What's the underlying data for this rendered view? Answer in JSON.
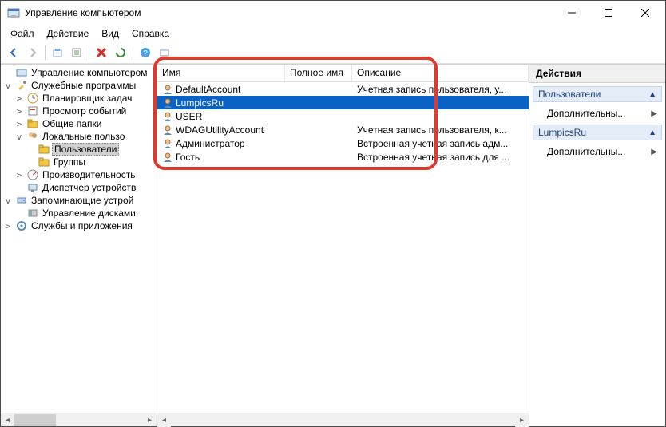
{
  "window": {
    "title": "Управление компьютером"
  },
  "menu": {
    "file": "Файл",
    "action": "Действие",
    "view": "Вид",
    "help": "Справка"
  },
  "tree": {
    "root": "Управление компьютером",
    "services": "Служебные программы",
    "scheduler": "Планировщик задач",
    "events": "Просмотр событий",
    "shared": "Общие папки",
    "localusers": "Локальные пользо",
    "usersnode": "Пользователи",
    "groupsnode": "Группы",
    "perf": "Производительность",
    "devmgr": "Диспетчер устройств",
    "storage": "Запоминающие устрой",
    "diskmgmt": "Управление дисками",
    "svcapps": "Службы и приложения"
  },
  "columns": {
    "name": "Имя",
    "fullname": "Полное имя",
    "description": "Описание"
  },
  "users": [
    {
      "name": "DefaultAccount",
      "full": "",
      "desc": "Учетная запись пользователя, у..."
    },
    {
      "name": "LumpicsRu",
      "full": "",
      "desc": ""
    },
    {
      "name": "USER",
      "full": "",
      "desc": ""
    },
    {
      "name": "WDAGUtilityAccount",
      "full": "",
      "desc": "Учетная запись пользователя, к..."
    },
    {
      "name": "Администратор",
      "full": "",
      "desc": "Встроенная учетная запись адм..."
    },
    {
      "name": "Гость",
      "full": "",
      "desc": "Встроенная учетная запись для ..."
    }
  ],
  "actions": {
    "header": "Действия",
    "section1": "Пользователи",
    "more1": "Дополнительны...",
    "section2": "LumpicsRu",
    "more2": "Дополнительны..."
  }
}
